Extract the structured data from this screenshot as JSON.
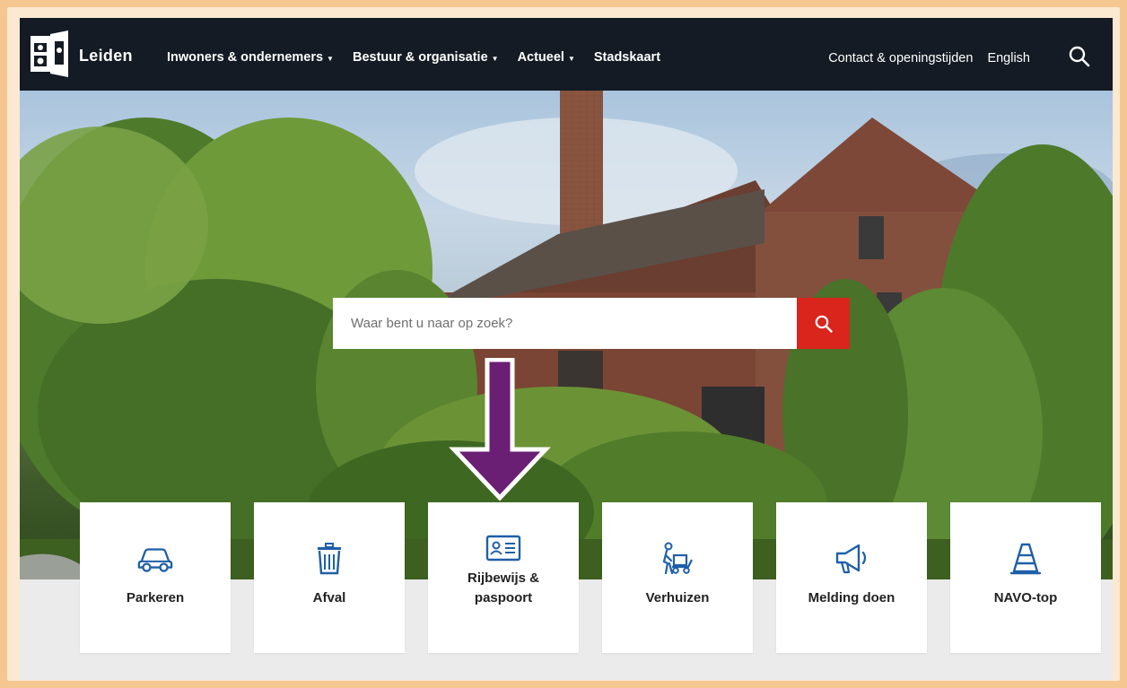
{
  "header": {
    "brand": "Leiden",
    "nav": [
      {
        "label": "Inwoners & ondernemers",
        "has_caret": true
      },
      {
        "label": "Bestuur & organisatie",
        "has_caret": true
      },
      {
        "label": "Actueel",
        "has_caret": true
      },
      {
        "label": "Stadskaart",
        "has_caret": false
      }
    ],
    "contact_link": "Contact & openingstijden",
    "language_link": "English",
    "search_icon": "search-icon"
  },
  "search": {
    "placeholder": "Waar bent u naar op zoek?",
    "button_icon": "search-icon"
  },
  "tiles": [
    {
      "label": "Parkeren",
      "icon": "car-icon"
    },
    {
      "label": "Afval",
      "icon": "trash-icon"
    },
    {
      "label": "Rijbewijs & paspoort",
      "icon": "id-card-icon"
    },
    {
      "label": "Verhuizen",
      "icon": "moving-icon"
    },
    {
      "label": "Melding doen",
      "icon": "megaphone-icon"
    },
    {
      "label": "NAVO-top",
      "icon": "cone-icon"
    }
  ],
  "colors": {
    "header_bg": "#141b24",
    "accent_red": "#d9251c",
    "icon_blue": "#1f5fa8",
    "arrow_purple": "#6a1e74",
    "frame_orange": "#f6c690"
  }
}
